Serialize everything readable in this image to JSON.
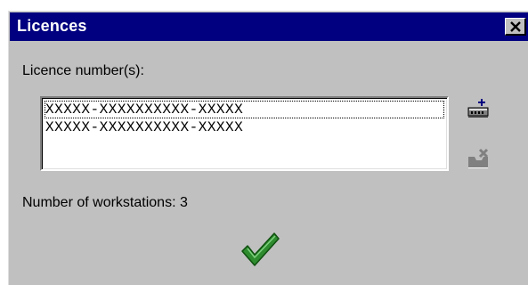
{
  "dialog": {
    "title": "Licences",
    "close_label": "×"
  },
  "licences": {
    "label": "Licence number(s):",
    "items": [
      "XXXXX-XXXXXXXXXX-XXXXX",
      "XXXXX-XXXXXXXXXX-XXXXX"
    ],
    "add_icon": "add-licence-icon",
    "remove_icon": "remove-licence-icon"
  },
  "workstations": {
    "text": "Number of workstations: 3"
  },
  "ok_icon": "checkmark-icon",
  "colors": {
    "titlebar": "#000080",
    "dialog_bg": "#c0c0c0",
    "checkmark": "#2e8b2e"
  }
}
